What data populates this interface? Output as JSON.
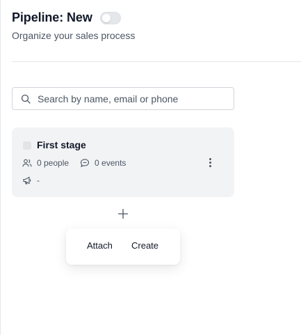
{
  "header": {
    "title": "Pipeline: New",
    "subtitle": "Organize your sales process",
    "toggle_on": false
  },
  "search": {
    "placeholder": "Search by name, email or phone",
    "value": ""
  },
  "stage": {
    "name": "First stage",
    "people": "0 people",
    "events": "0 events",
    "source": "-"
  },
  "add_menu": {
    "attach_label": "Attach",
    "create_label": "Create"
  },
  "icons": {
    "search": "search-icon",
    "people": "people-icon",
    "events": "chat-bubble-icon",
    "source": "megaphone-icon",
    "more": "more-vertical-icon",
    "add": "plus-icon"
  },
  "colors": {
    "card_bg": "#f2f3f5",
    "text_primary": "#111827",
    "text_secondary": "#4b5563",
    "divider": "#e5e7eb"
  }
}
